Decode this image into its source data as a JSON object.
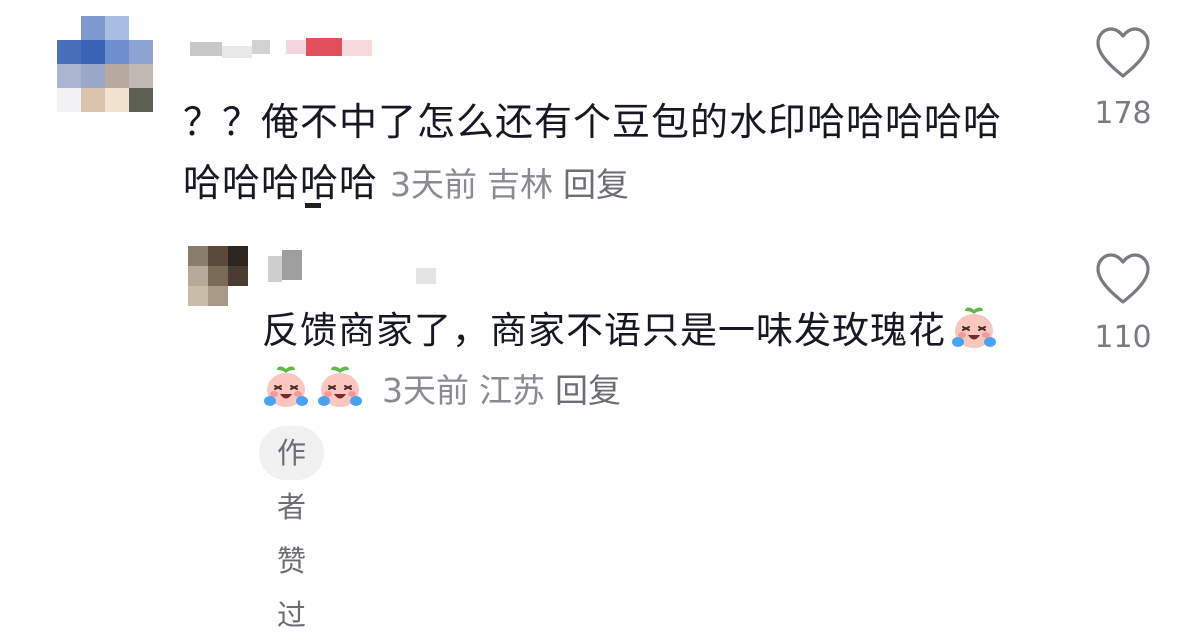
{
  "comments": [
    {
      "text": "？？俺不中了怎么还有个豆包的水印哈哈哈哈哈哈哈哈哈哈",
      "time": "3天前",
      "location": "吉林",
      "reply_label": "回复",
      "likes": "178"
    }
  ],
  "reply": {
    "text": "反馈商家了，商家不语只是一味发玫瑰花",
    "emoji_icons": [
      "crying-peach-emoji",
      "crying-peach-emoji",
      "crying-peach-emoji"
    ],
    "time": "3天前",
    "location": "江苏",
    "reply_label": "回复",
    "likes": "110",
    "author_badge": "作者赞过"
  },
  "colors": {
    "text": "#161823",
    "meta": "#8a8a91",
    "badge_bg": "#f1f1f2",
    "icon": "#7a7a80"
  }
}
